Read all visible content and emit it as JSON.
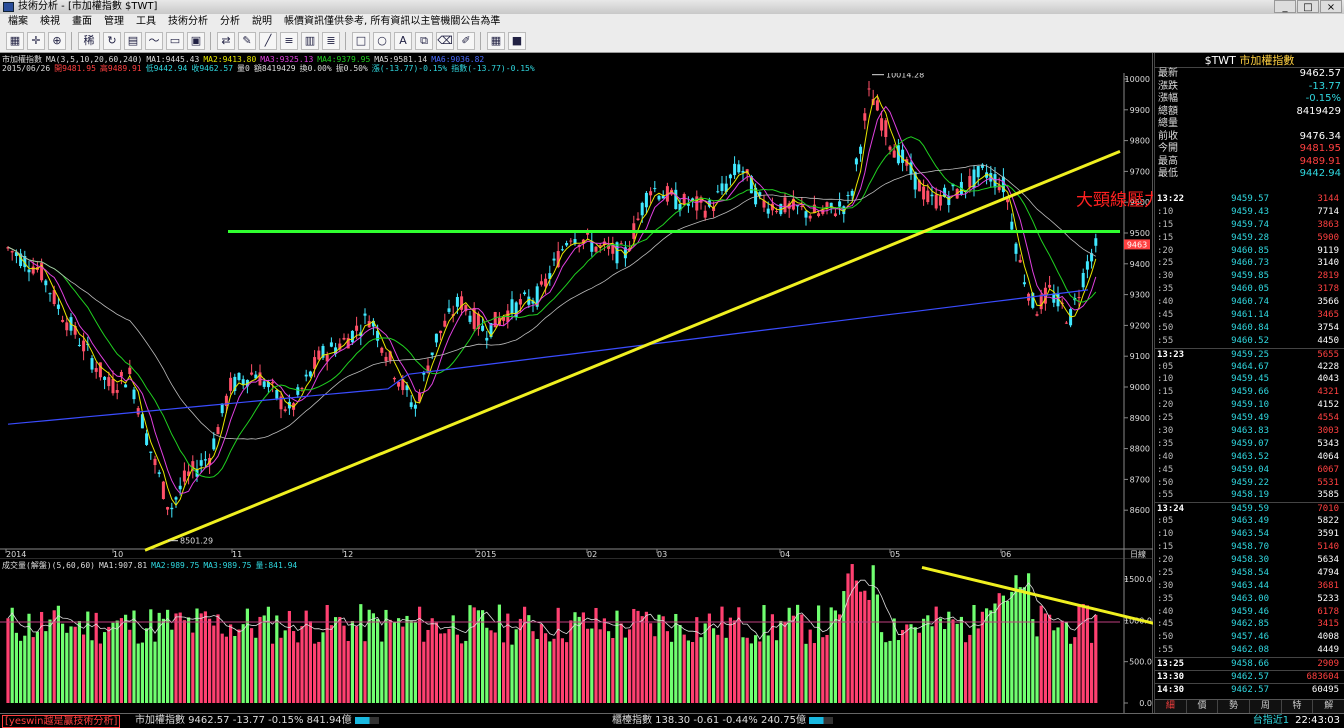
{
  "window": {
    "title": "技術分析 - [市加權指數 $TWT]",
    "buttons": [
      "_",
      "□",
      "×"
    ]
  },
  "menu": [
    "檔案",
    "検視",
    "畫面",
    "管理",
    "工具",
    "技術分析",
    "分析",
    "說明",
    "帳價資訊僅供參考, 所有資訊以主管機關公告為準"
  ],
  "toolbar": {
    "icons": [
      "grid-icon",
      "crosshair-icon",
      "zoom-icon",
      "period-label",
      "refresh-icon",
      "grid2-icon",
      "ma-icon",
      "chart1-icon",
      "chart2-icon",
      "compare-icon",
      "draw-icon",
      "line-icon",
      "fib-icon",
      "bars-icon",
      "cycle-icon",
      "rect-icon",
      "ellipse-icon",
      "text-icon",
      "copy-icon",
      "erase-icon",
      "pen-icon",
      "table-icon",
      "save-icon"
    ],
    "period": "稀"
  },
  "chart": {
    "info_line1": [
      [
        "w",
        "市加權指數"
      ],
      [
        "w",
        "MA(3,5,10,20,60,240)"
      ],
      [
        "w",
        "MA1:9445.43"
      ],
      [
        "y",
        "MA2:9413.80"
      ],
      [
        "m",
        "MA3:9325.13"
      ],
      [
        "g",
        "MA4:9379.95"
      ],
      [
        "w",
        "MA5:9581.14"
      ],
      [
        "b",
        "MA6:9036.82"
      ]
    ],
    "info_line2": [
      [
        "w",
        "2015/06/26"
      ],
      [
        "r",
        "開9481.95"
      ],
      [
        "r",
        "高9489.91"
      ],
      [
        "c",
        "低9442.94"
      ],
      [
        "c",
        "收9462.57"
      ],
      [
        "w",
        "量0"
      ],
      [
        "w",
        "額8419429"
      ],
      [
        "w",
        "換0.00%"
      ],
      [
        "w",
        "振0.50%"
      ],
      [
        "c",
        "漲(-13.77)-0.15%"
      ],
      [
        "c",
        "指數(-13.77)-0.15%"
      ]
    ],
    "y_ticks": [
      "10000",
      "9900",
      "9800",
      "9700",
      "9600",
      "9500",
      "9400",
      "9300",
      "9200",
      "9100",
      "9000",
      "8900",
      "8800",
      "8700",
      "8600"
    ],
    "x_ticks": [
      "2014",
      "10",
      "11",
      "12",
      "2015",
      "02",
      "03",
      "04",
      "05",
      "06"
    ],
    "x_end_label": "日線",
    "high_label": "10014.28",
    "low_label": "8501.29",
    "price_tag": "9463",
    "annotation": "大頸線壓力",
    "colors": {
      "up": "#ff5068",
      "down": "#40e8ff",
      "neckline": "#30ff30",
      "trend": "#f0f020"
    }
  },
  "volume": {
    "info": [
      [
        "w",
        "成交量(解盤)(5,60,60)"
      ],
      [
        "w",
        "MA1:907.81"
      ],
      [
        "c",
        "MA2:989.75"
      ],
      [
        "c",
        "MA3:989.75"
      ],
      [
        "c",
        "量:841.94"
      ]
    ],
    "y_ticks": [
      "1500.0",
      "1000.0",
      "500.0",
      "0.0"
    ]
  },
  "quote": {
    "symbol": "$TWT",
    "name": "市加權指數",
    "rows": [
      [
        "最新",
        "9462.57",
        "#fff"
      ],
      [
        "漲跌",
        "-13.77",
        "#30d8e0"
      ],
      [
        "漲幅",
        "-0.15%",
        "#30d8e0"
      ],
      [
        "總額",
        "8419429",
        "#fff"
      ],
      [
        "總量",
        "",
        "#fff"
      ],
      [
        "前收",
        "9476.34",
        "#fff"
      ],
      [
        "今開",
        "9481.95",
        "#ff4040"
      ],
      [
        "最高",
        "9489.91",
        "#ff4040"
      ],
      [
        "最低",
        "9442.94",
        "#30d8e0"
      ]
    ],
    "ticks": [
      [
        "13:22",
        "9459.57",
        "3144"
      ],
      [
        ":10",
        "9459.43",
        "7714"
      ],
      [
        ":15",
        "9459.74",
        "3863"
      ],
      [
        ":15",
        "9459.28",
        "5900"
      ],
      [
        ":20",
        "9460.85",
        "9119"
      ],
      [
        ":25",
        "9460.73",
        "3140"
      ],
      [
        ":30",
        "9459.85",
        "2819"
      ],
      [
        ":35",
        "9460.05",
        "3178"
      ],
      [
        ":40",
        "9460.74",
        "3566"
      ],
      [
        ":45",
        "9461.14",
        "3465"
      ],
      [
        ":50",
        "9460.84",
        "3754"
      ],
      [
        ":55",
        "9460.52",
        "4450"
      ],
      [
        "13:23",
        "9459.25",
        "5655"
      ],
      [
        ":05",
        "9464.67",
        "4228"
      ],
      [
        ":10",
        "9459.45",
        "4043"
      ],
      [
        ":15",
        "9459.66",
        "4321"
      ],
      [
        ":20",
        "9459.10",
        "4152"
      ],
      [
        ":25",
        "9459.49",
        "4554"
      ],
      [
        ":30",
        "9463.83",
        "3003"
      ],
      [
        ":35",
        "9459.07",
        "5343"
      ],
      [
        ":40",
        "9463.52",
        "4064"
      ],
      [
        ":45",
        "9459.04",
        "6067"
      ],
      [
        ":50",
        "9459.22",
        "5531"
      ],
      [
        ":55",
        "9458.19",
        "3585"
      ],
      [
        "13:24",
        "9459.59",
        "7010"
      ],
      [
        ":05",
        "9463.49",
        "5822"
      ],
      [
        ":10",
        "9463.54",
        "3591"
      ],
      [
        ":15",
        "9458.70",
        "5140"
      ],
      [
        ":20",
        "9458.30",
        "5634"
      ],
      [
        ":25",
        "9458.54",
        "4794"
      ],
      [
        ":30",
        "9463.44",
        "3681"
      ],
      [
        ":35",
        "9463.00",
        "5233"
      ],
      [
        ":40",
        "9459.46",
        "6178"
      ],
      [
        ":45",
        "9462.85",
        "3415"
      ],
      [
        ":50",
        "9457.46",
        "4008"
      ],
      [
        ":55",
        "9462.08",
        "4449"
      ],
      [
        "13:25",
        "9458.66",
        "2909"
      ],
      [
        "13:30",
        "9462.57",
        "683604"
      ],
      [
        "14:30",
        "9462.57",
        "60495"
      ]
    ],
    "tabs": [
      "細",
      "價",
      "勢",
      "周",
      "特",
      "解"
    ]
  },
  "status": {
    "left": "[yeswin越是贏技術分析]",
    "idx1": "市加權指數  9462.57 -13.77 -0.15% 841.94億",
    "idx2": "櫃檯指數  138.30 -0.61 -0.44% 240.75億",
    "right_idx": "台指近1",
    "time": "22:43:03"
  }
}
